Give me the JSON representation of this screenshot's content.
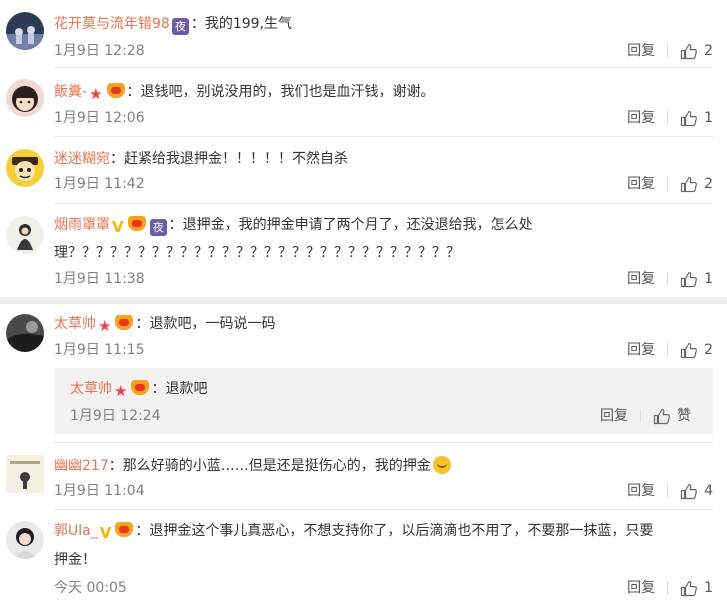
{
  "labels": {
    "reply": "回复",
    "like_text": "赞"
  },
  "comments": [
    {
      "user": "花开莫与流年错98",
      "text": "：我的199,生气",
      "time": "1月9日 12:28",
      "likes": "2"
    },
    {
      "user": "飯糞-",
      "text": "：退钱吧，别说没用的，我们也是血汗钱，谢谢。",
      "time": "1月9日 12:06",
      "likes": "1"
    },
    {
      "user": "迷迷糊宛",
      "text": "：赶紧给我退押金！！！！！不然自杀",
      "time": "1月9日 11:42",
      "likes": "2"
    },
    {
      "user": "烟雨罩罩",
      "text": "：退押金，我的押金申请了两个月了，还没退给我，怎么处",
      "text2": "理？？？？？？？？？？？？？？？？？？？？？？？？？？？？",
      "time": "1月9日 11:38",
      "likes": "1"
    },
    {
      "user": "太草帅",
      "text": "：退款吧，一码说一码",
      "time": "1月9日 11:15",
      "likes": "2"
    },
    {
      "user": "太草帅",
      "text": "：退款吧",
      "time": "1月9日 12:24"
    },
    {
      "user": "幽幽217",
      "text": "：那么好骑的小蓝……但是还是挺伤心的，我的押金",
      "time": "1月9日 11:04",
      "likes": "4"
    },
    {
      "user": "郭Ula_",
      "text": "：退押金这个事儿真恶心，不想支持你了，以后滴滴也不用了，不要那一抹蓝，只要",
      "text2": "押金！",
      "time": "今天 00:05",
      "likes": "1"
    }
  ],
  "icons": {
    "like": "thumbs-up-icon",
    "star": "star-icon",
    "vip": "vip-v-icon",
    "crown": "crown-icon",
    "night": "night-badge-icon",
    "emoji": "sad-smile-emoji-icon"
  },
  "colors": {
    "username": "#eb7350",
    "time": "#808080",
    "badge_star": "#f1403c",
    "badge_v": "#f7b500",
    "night_badge": "#6b5ba8"
  }
}
